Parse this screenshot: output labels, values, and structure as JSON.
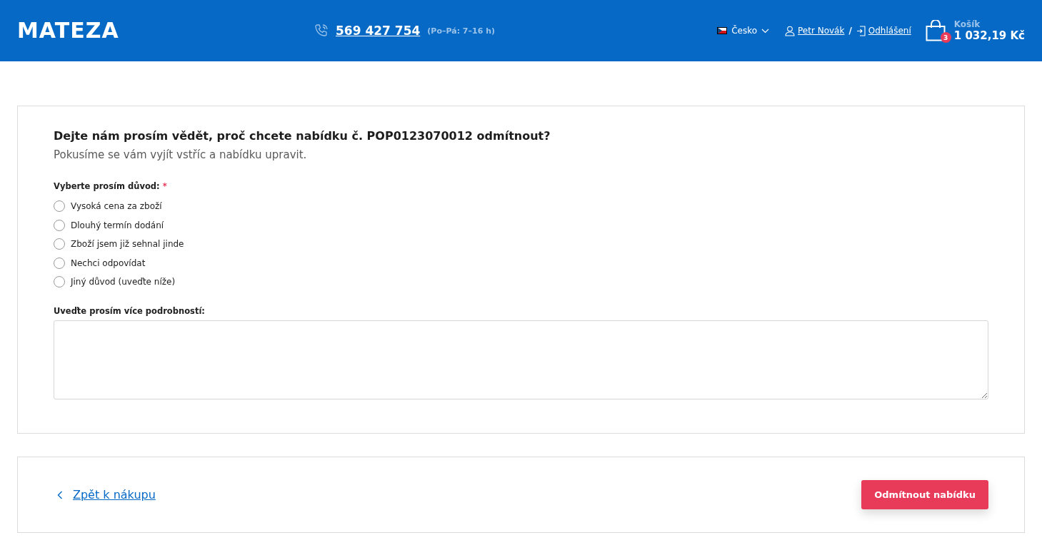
{
  "header": {
    "logo": "MATEZA",
    "phone": "569 427 754",
    "hours": "(Po–Pá: 7–16 h)",
    "country": "Česko",
    "user": "Petr Novák",
    "separator": "/",
    "logout": "Odhlášení",
    "cart": {
      "label": "Košík",
      "count": "3",
      "total": "1 032,19 Kč"
    }
  },
  "form": {
    "title": "Dejte nám prosím vědět, proč chcete nabídku č. POP0123070012 odmítnout?",
    "subtitle": "Pokusíme se vám vyjít vstříc a nabídku upravit.",
    "reason_label": "Vyberte prosím důvod:",
    "required_mark": "*",
    "reasons": [
      {
        "label": "Vysoká cena za zboží",
        "selected": false
      },
      {
        "label": "Dlouhý termín dodání",
        "selected": false
      },
      {
        "label": "Zboží jsem již sehnal jinde",
        "selected": false
      },
      {
        "label": "Nechci odpovídat",
        "selected": false
      },
      {
        "label": "Jiný důvod (uveďte níže)",
        "selected": false
      }
    ],
    "details_label": "Uveďte prosím více podrobností:"
  },
  "footer": {
    "back_link": "Zpět k nákupu",
    "reject_button": "Odmítnout nabídku"
  }
}
